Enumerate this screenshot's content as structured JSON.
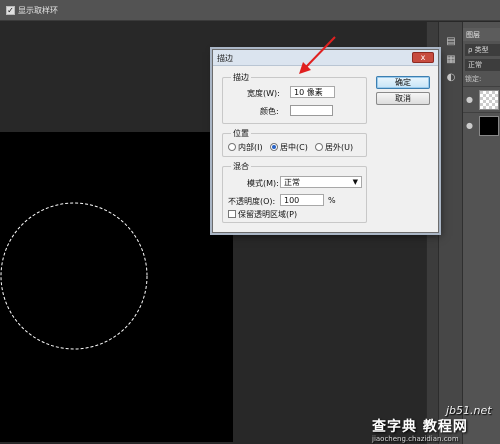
{
  "options_bar": {
    "show_sampling_ring_label": "显示取样环",
    "show_sampling_ring_checked": true
  },
  "layers_panel": {
    "tab_label": "图层",
    "filter_label": "ρ 类型",
    "blend_mode": "正常",
    "lock_label": "锁定:"
  },
  "dialog": {
    "title": "描边",
    "stroke_group": {
      "legend": "描边",
      "width_label": "宽度(W):",
      "width_value": "10 像素",
      "color_label": "颜色:"
    },
    "position_group": {
      "legend": "位置",
      "options": [
        "内部(I)",
        "居中(C)",
        "居外(U)"
      ],
      "selected": "居中(C)"
    },
    "blend_group": {
      "legend": "混合",
      "mode_label": "模式(M):",
      "mode_value": "正常",
      "opacity_label": "不透明度(O):",
      "opacity_value": "100",
      "opacity_unit": "%",
      "preserve_label": "保留透明区域(P)",
      "preserve_checked": false
    },
    "ok_label": "确定",
    "cancel_label": "取消",
    "close_label": "x"
  },
  "watermark": {
    "site": "jb51.net",
    "brand": "查字典 教程网",
    "url": "jiaocheng.chazidian.com"
  },
  "colors": {
    "canvas": "#000000",
    "selection": "#ffffff",
    "arrow": "#e02020",
    "dialog_bg": "#f0f0f0"
  }
}
